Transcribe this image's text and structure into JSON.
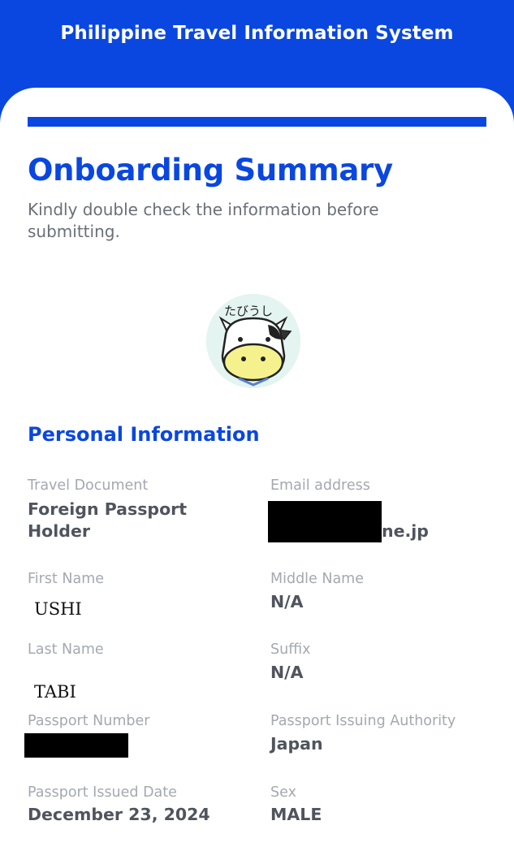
{
  "header": {
    "title": "Philippine Travel Information System"
  },
  "page": {
    "title": "Onboarding Summary",
    "subtitle": "Kindly double check the information before submitting."
  },
  "avatar": {
    "text": "たびうし"
  },
  "section": {
    "title": "Personal Information"
  },
  "fields": {
    "travel_document": {
      "label": "Travel Document",
      "value": "Foreign Passport Holder"
    },
    "email": {
      "label": "Email address",
      "value_visible": "ne.jp"
    },
    "first_name": {
      "label": "First Name",
      "value": "USHI"
    },
    "middle_name": {
      "label": "Middle Name",
      "value": "N/A"
    },
    "last_name": {
      "label": "Last Name",
      "value": "TABI"
    },
    "suffix": {
      "label": "Suffix",
      "value": "N/A"
    },
    "passport_number": {
      "label": "Passport Number"
    },
    "issuing_authority": {
      "label": "Passport Issuing Authority",
      "value": "Japan"
    },
    "issued_date": {
      "label": "Passport Issued Date",
      "value": "December 23, 2024"
    },
    "sex": {
      "label": "Sex",
      "value": "MALE"
    }
  },
  "colors": {
    "brand_blue": "#0a47e0",
    "label_gray": "#a4a8b0",
    "value_gray": "#4f545d"
  }
}
